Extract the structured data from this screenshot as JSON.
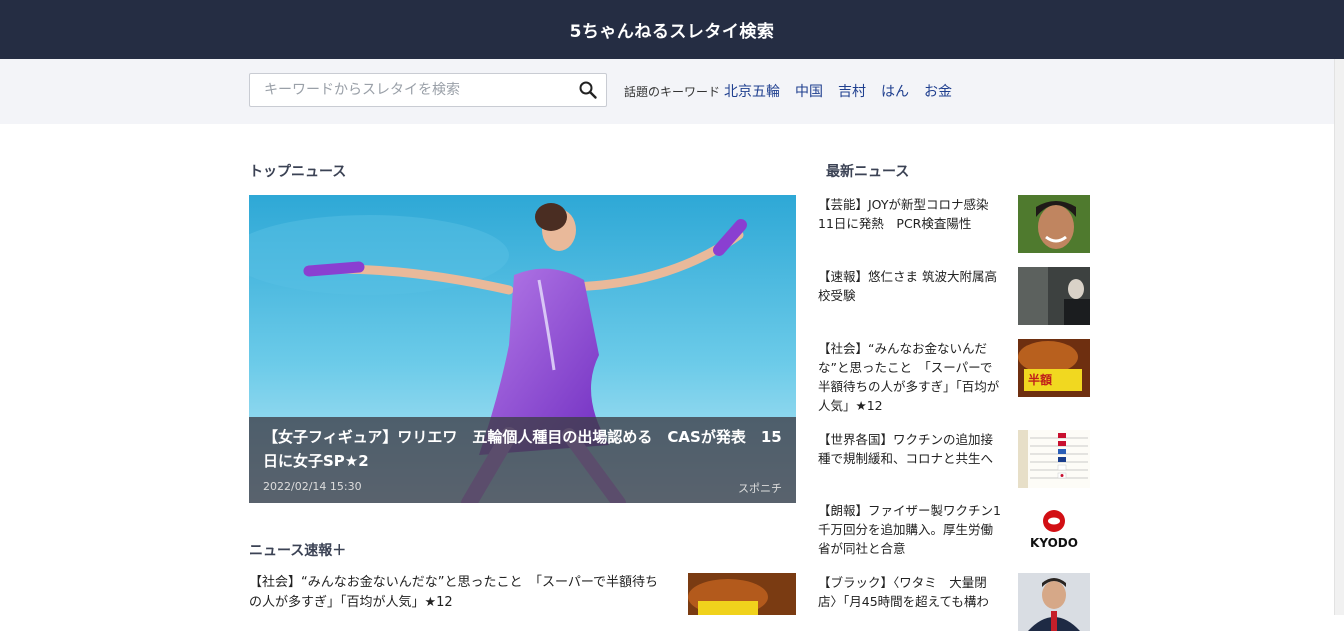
{
  "header": {
    "title": "5ちゃんねるスレタイ検索"
  },
  "search": {
    "placeholder": "キーワードからスレタイを検索",
    "value": "",
    "icon": "search-icon"
  },
  "keywords": {
    "label": "話題のキーワード",
    "items": [
      "北京五輪",
      "中国",
      "吉村",
      "はん",
      "お金"
    ]
  },
  "top_news": {
    "heading": "トップニュース",
    "hero": {
      "title": "【女子フィギュア】ワリエワ　五輪個人種目の出場認める　CASが発表　15日に女子SP★2",
      "date": "2022/02/14 15:30",
      "source": "スポニチ"
    }
  },
  "flash_news": {
    "heading": "ニュース速報＋",
    "items": [
      {
        "title": "【社会】“みんなお金ないんだな”と思ったこと　「スーパーで半額待ちの人が多すぎ」「百均が人気」★12"
      }
    ]
  },
  "latest_news": {
    "heading": "最新ニュース",
    "items": [
      {
        "title": "【芸能】JOYが新型コロナ感染　11日に発熱　PCR検査陽性"
      },
      {
        "title": "【速報】悠仁さま 筑波大附属高校受験"
      },
      {
        "title": "【社会】“みんなお金ないんだな”と思ったこと　「スーパーで半額待ちの人が多すぎ」「百均が人気」★12"
      },
      {
        "title": "【世界各国】ワクチンの追加接種で規制緩和、コロナと共生へ"
      },
      {
        "title": "【朗報】ファイザー製ワクチン1千万回分を追加購入。厚生労働省が同社と合意"
      },
      {
        "title": "【ブラック】〈ワタミ　大量閉店〉「月45時間を超えても構わ"
      }
    ],
    "thumb_texts": {
      "sale_badge": "半額",
      "kyodo": "KYODO"
    }
  },
  "colors": {
    "header_bg": "#252d43",
    "band_bg": "#f3f4f8",
    "link": "#1f3f8f"
  }
}
